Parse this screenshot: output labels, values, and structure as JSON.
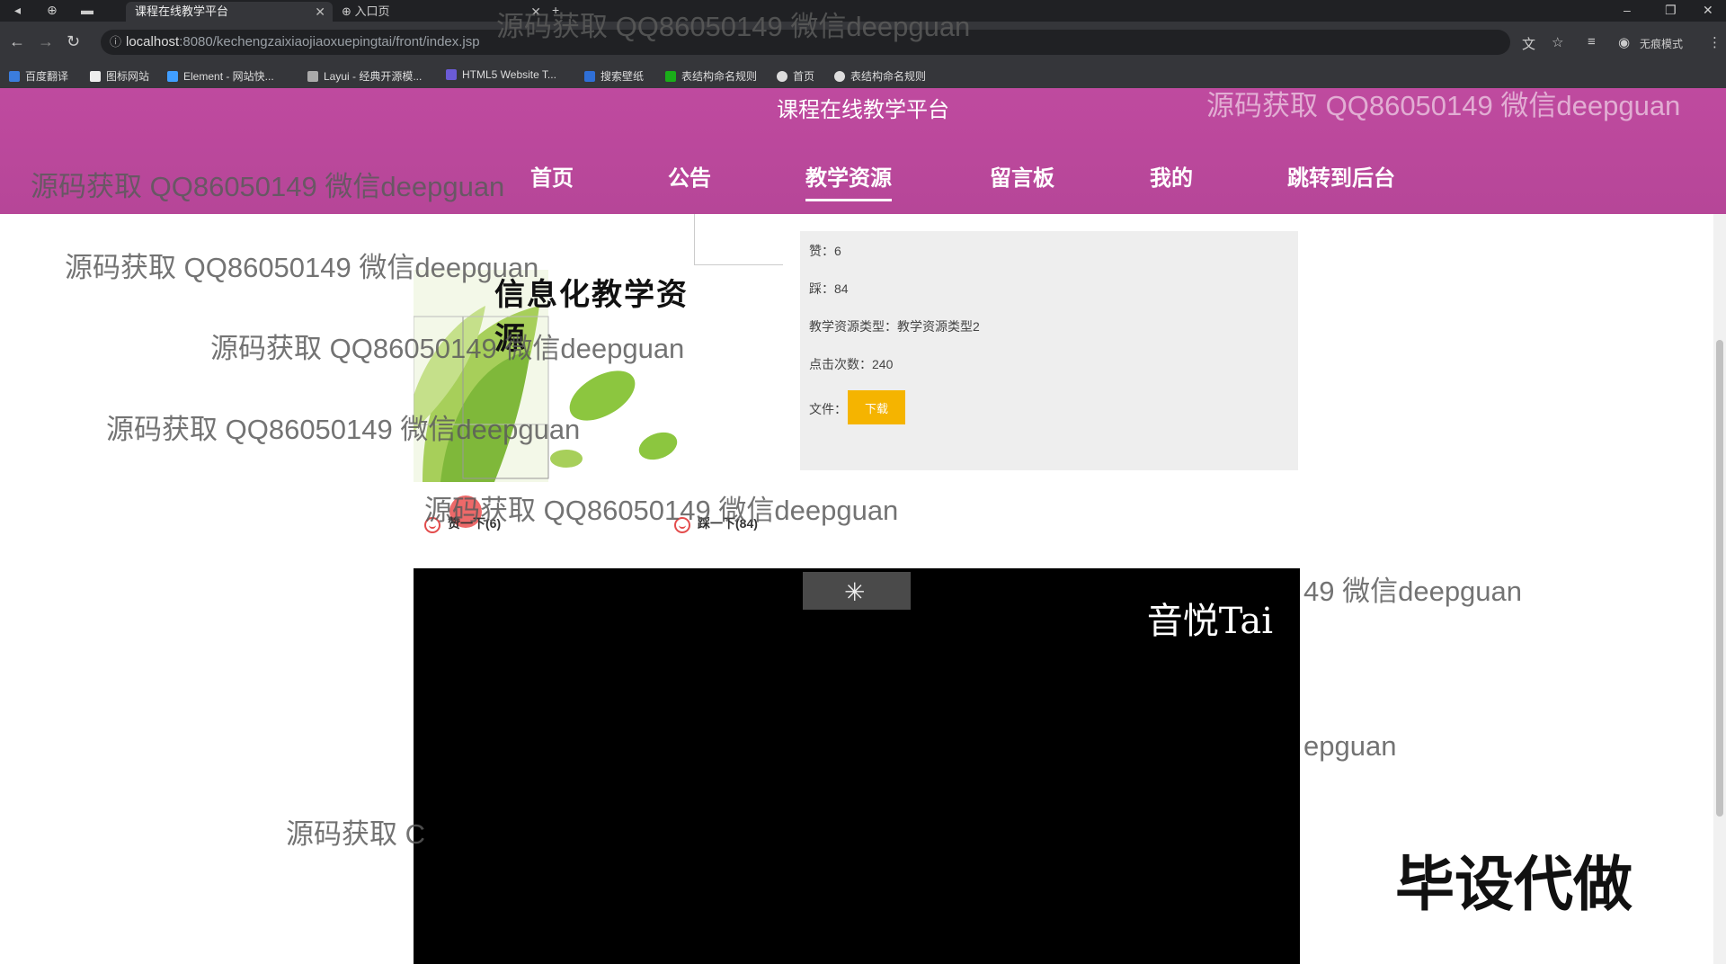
{
  "browser": {
    "tabs": [
      {
        "title": "课程在线教学平台",
        "active": true
      },
      {
        "title": "入口页",
        "active": false
      }
    ],
    "url_host": "localhost",
    "url_rest": ":8080/kechengzaixiaojiaoxuepingtai/front/index.jsp",
    "profile_label": "无痕模式",
    "bookmarks": [
      "百度翻译",
      "图标网站",
      "Element - 网站快...",
      "Layui - 经典开源模...",
      "HTML5 Website T...",
      "搜索壁纸",
      "表结构命名规则",
      "首页",
      "表结构命名规则"
    ]
  },
  "site": {
    "title": "课程在线教学平台",
    "menu": [
      "首页",
      "公告",
      "教学资源",
      "留言板",
      "我的",
      "跳转到后台"
    ],
    "active_menu": "教学资源"
  },
  "resource": {
    "image_caption": "信息化教学资源",
    "likes_row": "赞：6",
    "dislikes_row": "踩：84",
    "type_row": "教学资源类型：教学资源类型2",
    "clicks_row": "点击次数：240",
    "file_label": "文件：",
    "download_label": "下载",
    "like_button": "赞一下(6)",
    "dislike_button": "踩一下(84)"
  },
  "video": {
    "logo_text": "音悦Tai",
    "spinner_icon": "loading-spinner"
  },
  "overlay": {
    "big_text": "毕设代做",
    "watermark": "源码获取 QQ86050149 微信deepguan",
    "watermark_partial_1": "49 微信deepguan",
    "watermark_partial_2": "epguan",
    "watermark_partial_3": "源码获取 C"
  },
  "colors": {
    "header": "#bf4a9f",
    "download": "#f5b400",
    "panel": "#eeeeee"
  }
}
